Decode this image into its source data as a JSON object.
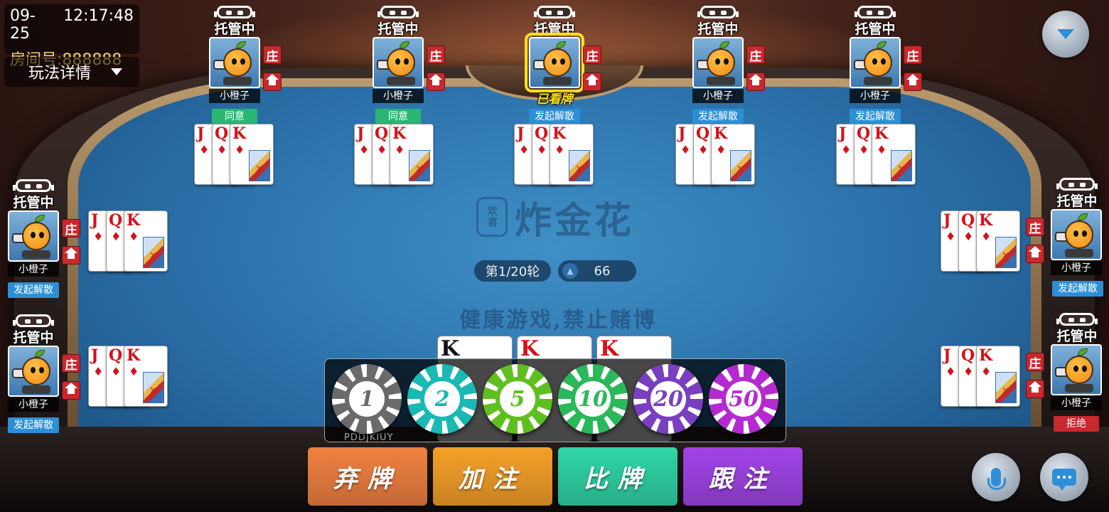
{
  "header": {
    "date": "09-25",
    "time": "12:17:48",
    "room_label": "房间号:888888",
    "rules_label": "玩法详情"
  },
  "table": {
    "logo_seal": "欢喜",
    "logo_text": "炸金花",
    "health_notice": "健康游戏,禁止赌博",
    "round_label": "第1/20轮",
    "pot_value": "66"
  },
  "seats": [
    {
      "auto_label": "托管中",
      "name": "小橙子",
      "dealer": "庄",
      "status": "同意",
      "status_type": "agree"
    },
    {
      "auto_label": "托管中",
      "name": "小橙子",
      "dealer": "庄",
      "status": "同意",
      "status_type": "agree"
    },
    {
      "auto_label": "托管中",
      "name": "已看牌",
      "dealer": "庄",
      "status": "发起解散",
      "status_type": "dissolve"
    },
    {
      "auto_label": "托管中",
      "name": "小橙子",
      "dealer": "庄",
      "status": "发起解散",
      "status_type": "dissolve"
    },
    {
      "auto_label": "托管中",
      "name": "小橙子",
      "dealer": "庄",
      "status": "发起解散",
      "status_type": "dissolve"
    },
    {
      "auto_label": "托管中",
      "name": "小橙子",
      "dealer": "庄",
      "status": "发起解散",
      "status_type": "dissolve"
    },
    {
      "auto_label": "托管中",
      "name": "小橙子",
      "dealer": "庄",
      "status": "发起解散",
      "status_type": "dissolve"
    },
    {
      "auto_label": "托管中",
      "name": "小橙子",
      "dealer": "庄",
      "status": "发起解散",
      "status_type": "dissolve"
    },
    {
      "auto_label": "托管中",
      "name": "小橙子",
      "dealer": "庄",
      "status": "拒绝",
      "status_type": "refuse"
    }
  ],
  "hand_cards": [
    "J",
    "Q",
    "K"
  ],
  "card_suit": "♦",
  "own_cards": [
    "K",
    "K",
    "K"
  ],
  "self_id": "PDDJKIUY",
  "chips": [
    {
      "value": "1",
      "color": "#6a6a6a"
    },
    {
      "value": "2",
      "color": "#19b9b4"
    },
    {
      "value": "5",
      "color": "#5fbf1e"
    },
    {
      "value": "10",
      "color": "#2ab85a"
    },
    {
      "value": "20",
      "color": "#7a3fc0"
    },
    {
      "value": "50",
      "color": "#b52ad0"
    }
  ],
  "actions": {
    "fold": "弃牌",
    "raise": "加注",
    "compare": "比牌",
    "call": "跟注"
  },
  "colors": {
    "highlight": "#ffe11a",
    "fold_btn": "#f08040",
    "raise_btn": "#f5a028",
    "compare_btn": "#2ed6a6",
    "call_btn": "#a043e8"
  }
}
